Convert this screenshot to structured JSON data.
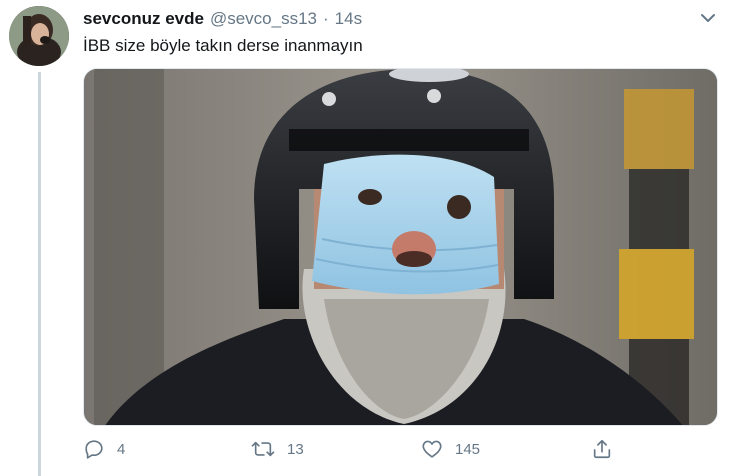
{
  "tweet": {
    "display_name": "sevconuz evde",
    "handle": "@sevco_ss13",
    "separator": "·",
    "timestamp": "14s",
    "text": "İBB size böyle takın derse inanmayın",
    "caret_icon": "chevron-down-icon"
  },
  "actions": {
    "reply": {
      "icon": "reply-icon",
      "count": "4"
    },
    "retweet": {
      "icon": "retweet-icon",
      "count": "13"
    },
    "like": {
      "icon": "heart-icon",
      "count": "145"
    },
    "share": {
      "icon": "share-icon"
    }
  },
  "colors": {
    "text_primary": "#14171a",
    "text_secondary": "#657786",
    "thread_line": "#ccd6dd"
  }
}
